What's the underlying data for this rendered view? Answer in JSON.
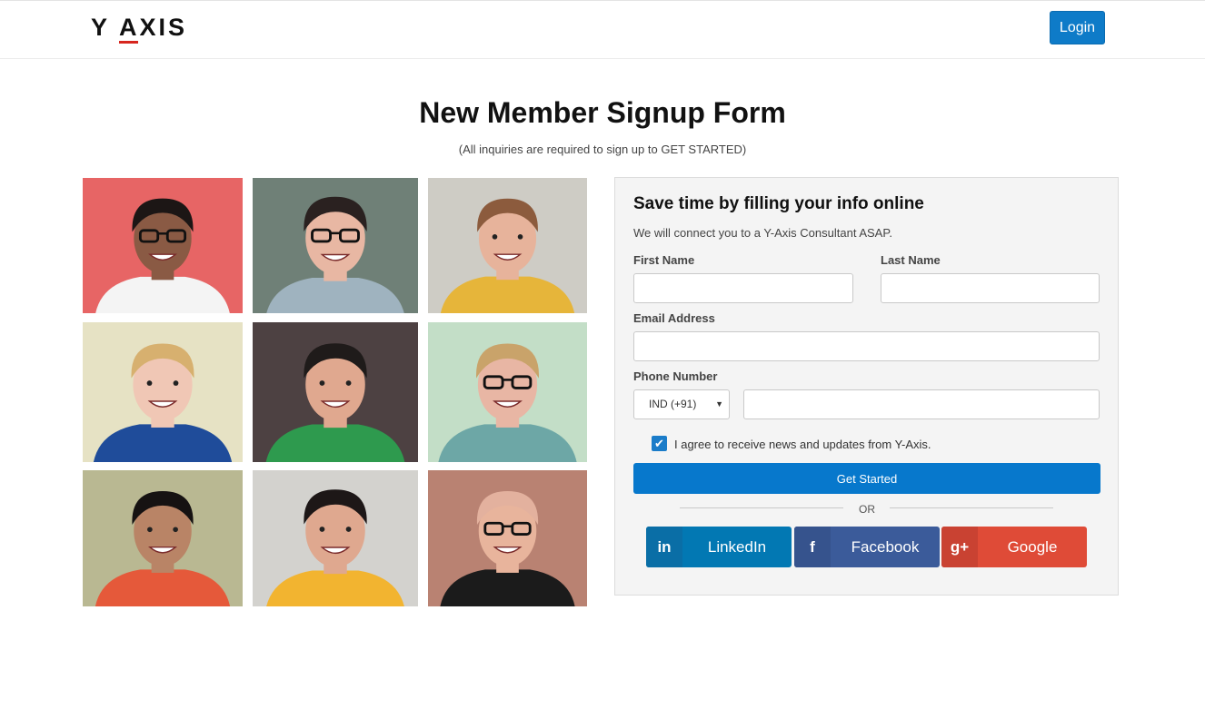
{
  "header": {
    "logo_left": "Y",
    "logo_a": "A",
    "logo_right": "XIS",
    "login_label": "Login",
    "accent_color": "#0e7bc8",
    "brand_red": "#d7261e"
  },
  "page": {
    "title": "New Member Signup Form",
    "subtitle": "(All inquiries are required to sign up to GET STARTED)"
  },
  "avatars": [
    {
      "name": "avatar-man-glasses-red-bg",
      "bg": "#e76565"
    },
    {
      "name": "avatar-woman-glasses-green-bg",
      "bg": "#6f8077"
    },
    {
      "name": "avatar-man-beard-grey-bg",
      "bg": "#ceccc5"
    },
    {
      "name": "avatar-woman-blonde-cream-bg",
      "bg": "#e6e2c4"
    },
    {
      "name": "avatar-man-green-sweater-dark-bg",
      "bg": "#4d4142"
    },
    {
      "name": "avatar-woman-glasses-mint-bg",
      "bg": "#c3dec7"
    },
    {
      "name": "avatar-man-curly-olive-bg",
      "bg": "#b9b892"
    },
    {
      "name": "avatar-woman-ponytail-grey-bg",
      "bg": "#d3d2ce"
    },
    {
      "name": "avatar-man-bald-brown-bg",
      "bg": "#b98272"
    }
  ],
  "form": {
    "title": "Save time by filling your info online",
    "description": "We will connect you to a Y-Axis Consultant ASAP.",
    "first_name_label": "First Name",
    "first_name_value": "",
    "last_name_label": "Last Name",
    "last_name_value": "",
    "email_label": "Email Address",
    "email_value": "",
    "phone_label": "Phone Number",
    "country_code": "IND (+91)",
    "phone_value": "",
    "agree_checked": true,
    "agree_text": "I agree to receive news and updates from Y-Axis.",
    "submit_label": "Get Started",
    "or_text": "OR"
  },
  "social": {
    "linkedin_icon": "in",
    "linkedin_label": "LinkedIn",
    "facebook_icon": "f",
    "facebook_label": "Facebook",
    "google_icon": "g+",
    "google_label": "Google"
  }
}
